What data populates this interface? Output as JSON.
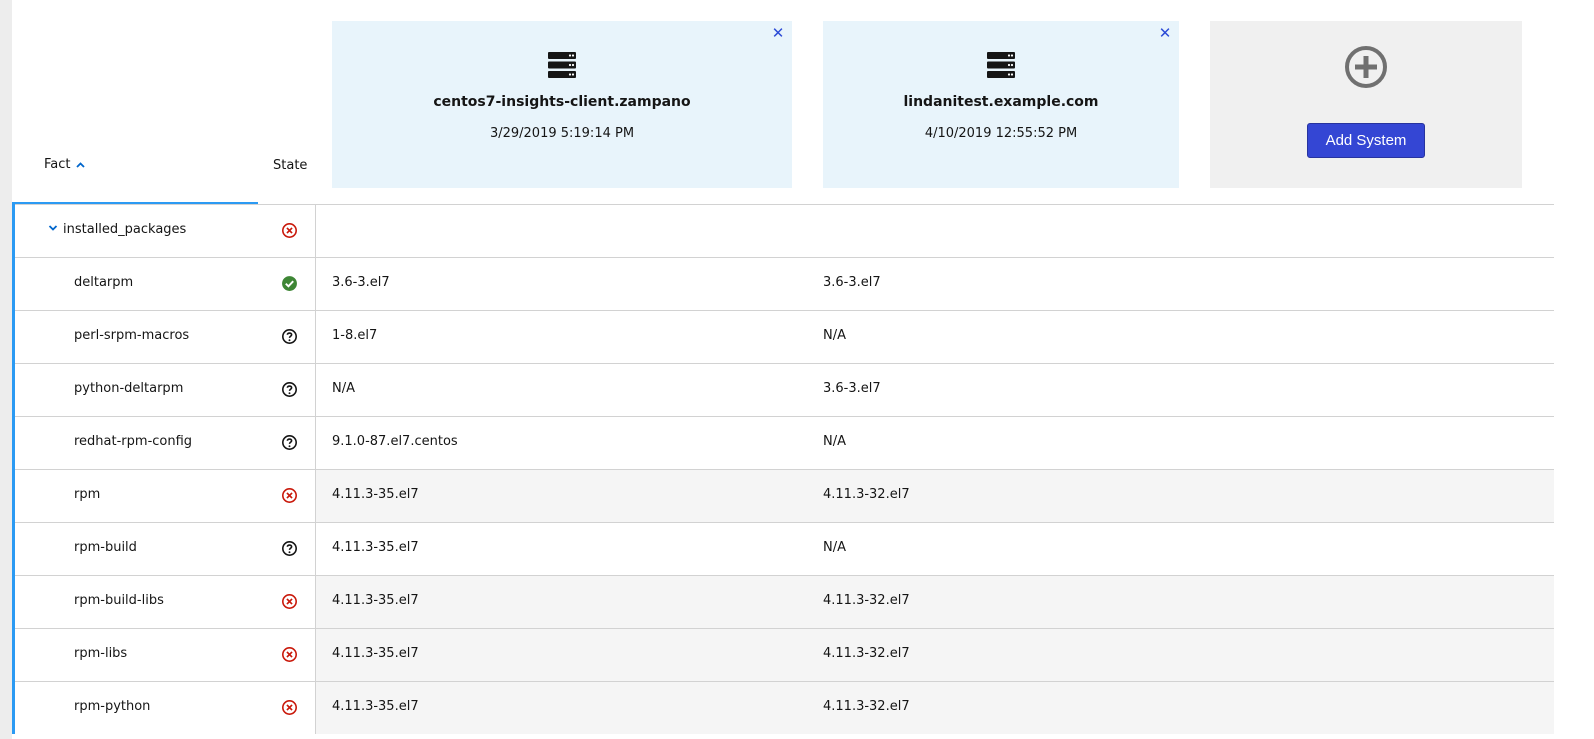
{
  "header": {
    "fact_label": "Fact",
    "state_label": "State"
  },
  "systems": [
    {
      "name": "centos7-insights-client.zampano",
      "date": "3/29/2019 5:19:14 PM",
      "icon": "server-icon"
    },
    {
      "name": "lindanitest.example.com",
      "date": "4/10/2019 12:55:52 PM",
      "icon": "server-icon"
    }
  ],
  "add_system": {
    "label": "Add System",
    "icon": "plus-circle-icon"
  },
  "rows": [
    {
      "fact": "installed_packages",
      "state": "different",
      "v1": "",
      "v2": ""
    },
    {
      "fact": "deltarpm",
      "state": "same",
      "v1": "3.6-3.el7",
      "v2": "3.6-3.el7"
    },
    {
      "fact": "perl-srpm-macros",
      "state": "unknown",
      "v1": "1-8.el7",
      "v2": "N/A"
    },
    {
      "fact": "python-deltarpm",
      "state": "unknown",
      "v1": "N/A",
      "v2": "3.6-3.el7"
    },
    {
      "fact": "redhat-rpm-config",
      "state": "unknown",
      "v1": "9.1.0-87.el7.centos",
      "v2": "N/A"
    },
    {
      "fact": "rpm",
      "state": "different",
      "v1": "4.11.3-35.el7",
      "v2": "4.11.3-32.el7"
    },
    {
      "fact": "rpm-build",
      "state": "unknown",
      "v1": "4.11.3-35.el7",
      "v2": "N/A"
    },
    {
      "fact": "rpm-build-libs",
      "state": "different",
      "v1": "4.11.3-35.el7",
      "v2": "4.11.3-32.el7"
    },
    {
      "fact": "rpm-libs",
      "state": "different",
      "v1": "4.11.3-35.el7",
      "v2": "4.11.3-32.el7"
    },
    {
      "fact": "rpm-python",
      "state": "different",
      "v1": "4.11.3-35.el7",
      "v2": "4.11.3-32.el7"
    }
  ],
  "colors": {
    "accent": "#2b9af3",
    "button": "#3446d4",
    "card_bg": "#e8f4fb",
    "different": "#c9190b",
    "same": "#3e8635"
  }
}
